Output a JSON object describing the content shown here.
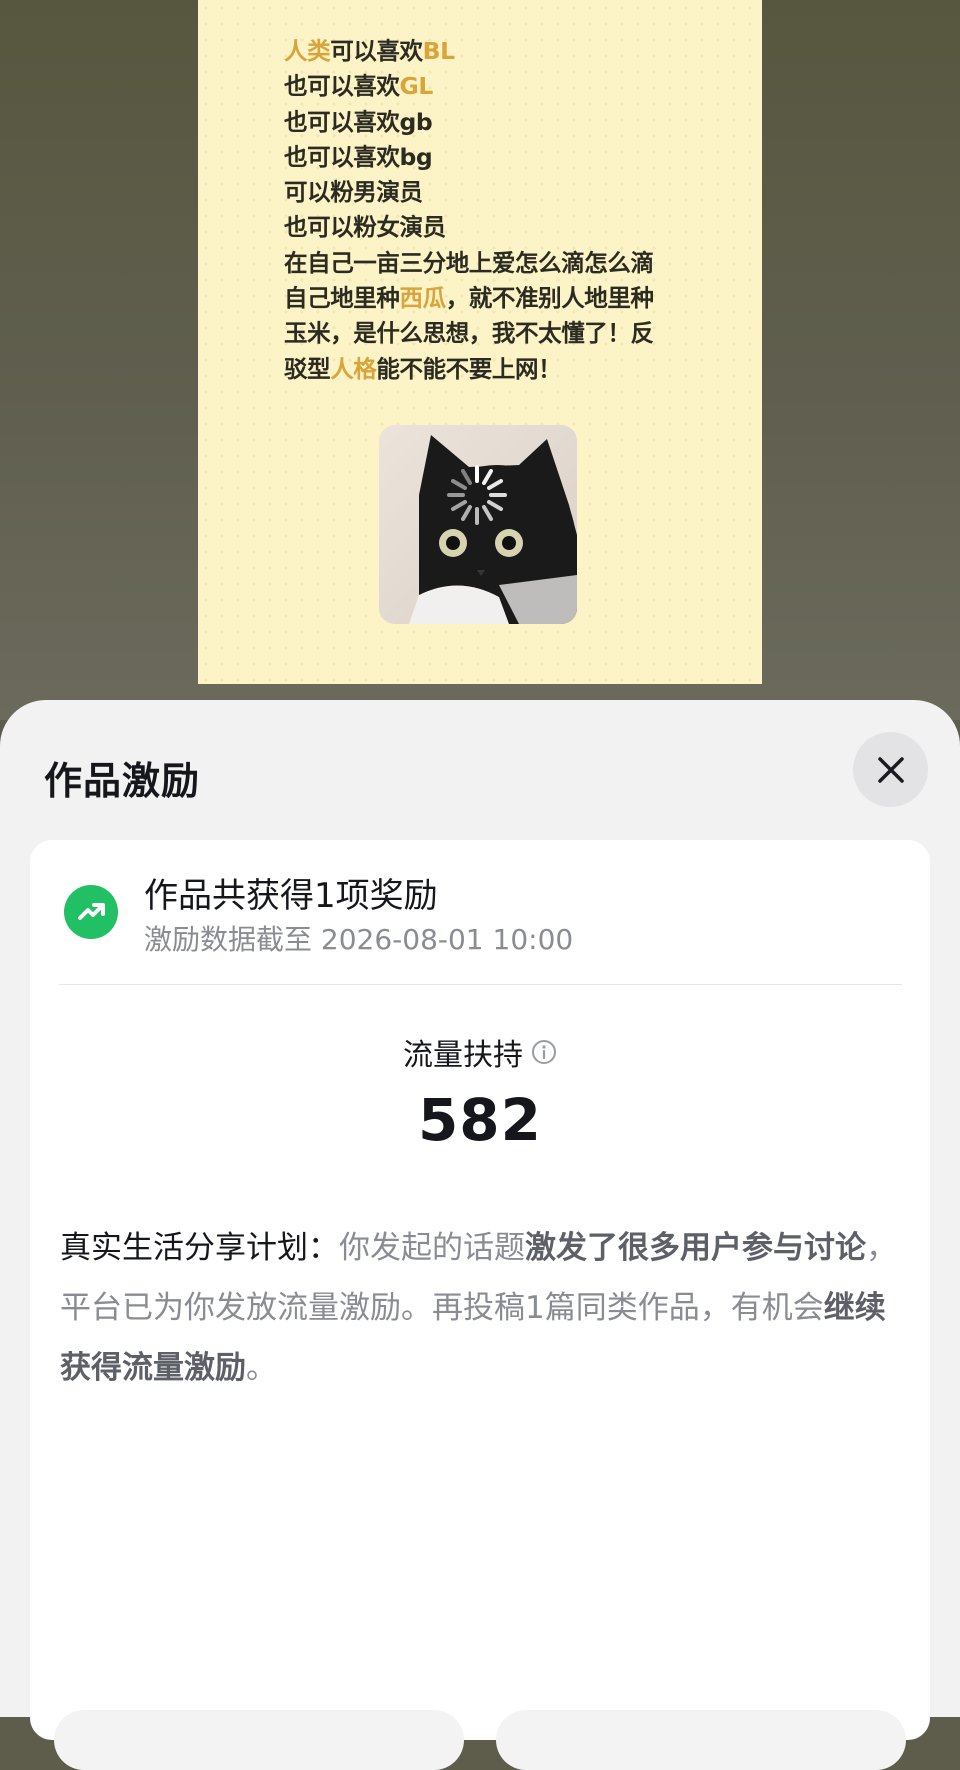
{
  "post": {
    "lines": [
      [
        {
          "t": "人类",
          "hl": true
        },
        {
          "t": "可以喜欢"
        },
        {
          "t": "BL",
          "hl": true
        }
      ],
      [
        {
          "t": "也可以喜欢"
        },
        {
          "t": "GL",
          "hl": true
        }
      ],
      [
        {
          "t": "也可以喜欢gb"
        }
      ],
      [
        {
          "t": "也可以喜欢bg"
        }
      ],
      [
        {
          "t": "可以粉男演员"
        }
      ],
      [
        {
          "t": "也可以粉女演员"
        }
      ],
      [
        {
          "t": "在自己一亩三分地上爱怎么滴怎么滴"
        }
      ],
      [
        {
          "t": "自己地里种"
        },
        {
          "t": "西瓜",
          "hl": true
        },
        {
          "t": "，就不准别人地里种"
        }
      ],
      [
        {
          "t": "玉米，是什么思想，我不太懂了！反"
        }
      ],
      [
        {
          "t": "驳型"
        },
        {
          "t": "人格",
          "hl": true
        },
        {
          "t": "能不能不要上网！"
        }
      ]
    ],
    "highlight_color": "#d9a43a",
    "image_icon": "cat-meme-loading"
  },
  "sheet": {
    "title": "作品激励",
    "close_icon": "close-icon",
    "award": {
      "icon": "trending-up-icon",
      "title": "作品共获得1项奖励",
      "subtitle": "激励数据截至 2026-08-01 10:00"
    },
    "metric": {
      "label": "流量扶持",
      "info_icon": "info-icon",
      "value": "582"
    },
    "description": {
      "lead": "真实生活分享计划：",
      "part1": "你发起的话题",
      "em1": "激发了很多用户参与讨论",
      "part2": "，平台已为你发放流量激励。再投稿1篇同类作品，有机会",
      "em2": "继续获得流量激励",
      "part3": "。"
    }
  },
  "colors": {
    "accent_green": "#22c064",
    "highlight_yellow": "#d9a43a",
    "text_primary": "#16171c",
    "text_secondary": "#8a8c93"
  }
}
